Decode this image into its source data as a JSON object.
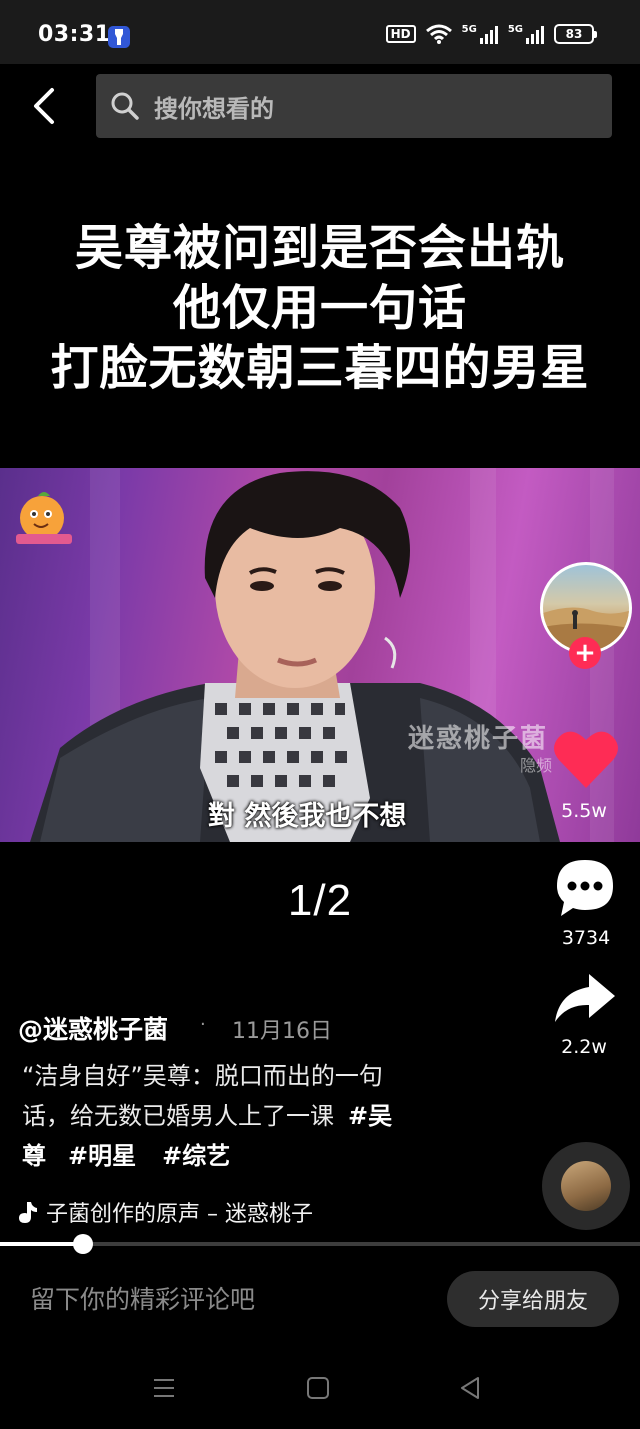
{
  "status_bar": {
    "time": "03:31",
    "hd_label": "HD",
    "signal_1_label": "5G",
    "signal_2_label": "5G",
    "battery_level": "83",
    "icons": [
      "flashlight-icon",
      "wifi-icon",
      "signal-icon",
      "battery-icon"
    ]
  },
  "header": {
    "back_icon": "chevron-left-icon",
    "search_icon": "search-icon",
    "search_placeholder": "搜你想看的"
  },
  "video": {
    "headline_lines": [
      "吴尊被问到是否会出轨",
      "他仅用一句话",
      "打脸无数朝三暮四的男星"
    ],
    "watermark": "迷惑桃子菌",
    "watermark_sub": "隐频",
    "subtitle": "對 然後我也不想",
    "page_indicator": "1/2"
  },
  "actions": {
    "likes": "5.5w",
    "comments": "3734",
    "shares": "2.2w",
    "follow_label": "+"
  },
  "post": {
    "author": "@迷惑桃子菌",
    "separator": "·",
    "date": "11月16日",
    "caption_line1": "“洁身自好”吴尊：脱口而出的一句",
    "caption_line2": "话，给无数已婚男人上了一课",
    "tag_1a": "#吴",
    "tag_1b": "尊",
    "tag_2": "#明星",
    "tag_3": "#综艺",
    "music": "子菌创作的原声 – 迷惑桃子"
  },
  "playback": {
    "progress": 0.13
  },
  "bottom_bar": {
    "comment_placeholder": "留下你的精彩评论吧",
    "share_label": "分享给朋友"
  },
  "colors": {
    "like": "#fe2c55",
    "follow": "#fe2c55",
    "background": "#000000"
  }
}
